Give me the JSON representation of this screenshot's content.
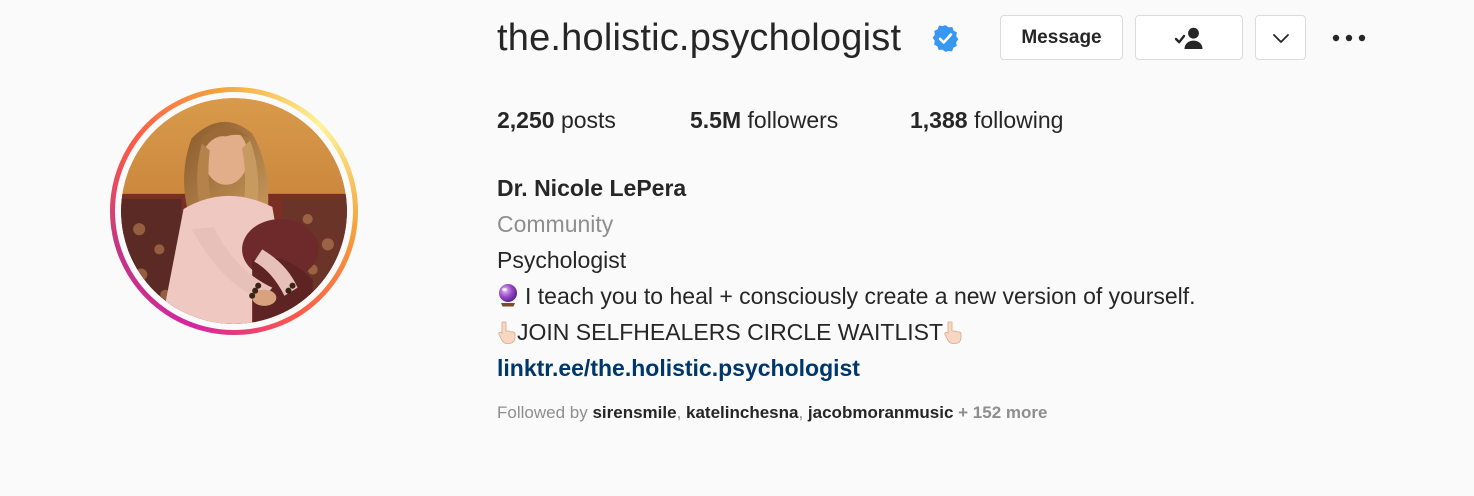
{
  "profile": {
    "username": "the.holistic.psychologist",
    "verified": true,
    "verified_color": "#3897f0"
  },
  "actions": {
    "message_label": "Message",
    "following_icon": "person-check-icon",
    "dropdown_icon": "chevron-down-icon",
    "more_icon": "more-options-icon"
  },
  "stats": {
    "posts_count": "2,250",
    "posts_label": "posts",
    "followers_count": "5.5M",
    "followers_label": "followers",
    "following_count": "1,388",
    "following_label": "following"
  },
  "bio": {
    "full_name": "Dr. Nicole LePera",
    "category": "Community",
    "title": "Psychologist",
    "line1_text": "I teach you to heal + consciously create a new version of yourself.",
    "line2_text": "JOIN SELFHEALERS CIRCLE WAITLIST",
    "link": "linktr.ee/the.holistic.psychologist"
  },
  "followed_by": {
    "prefix": "Followed by",
    "users": [
      "sirensmile",
      "katelinchesna",
      "jacobmoranmusic"
    ],
    "more": "+ 152 more"
  },
  "colors": {
    "link": "#00376b",
    "secondary_text": "#8e8e8e",
    "border": "#dbdbdb",
    "background": "#fafafa"
  }
}
